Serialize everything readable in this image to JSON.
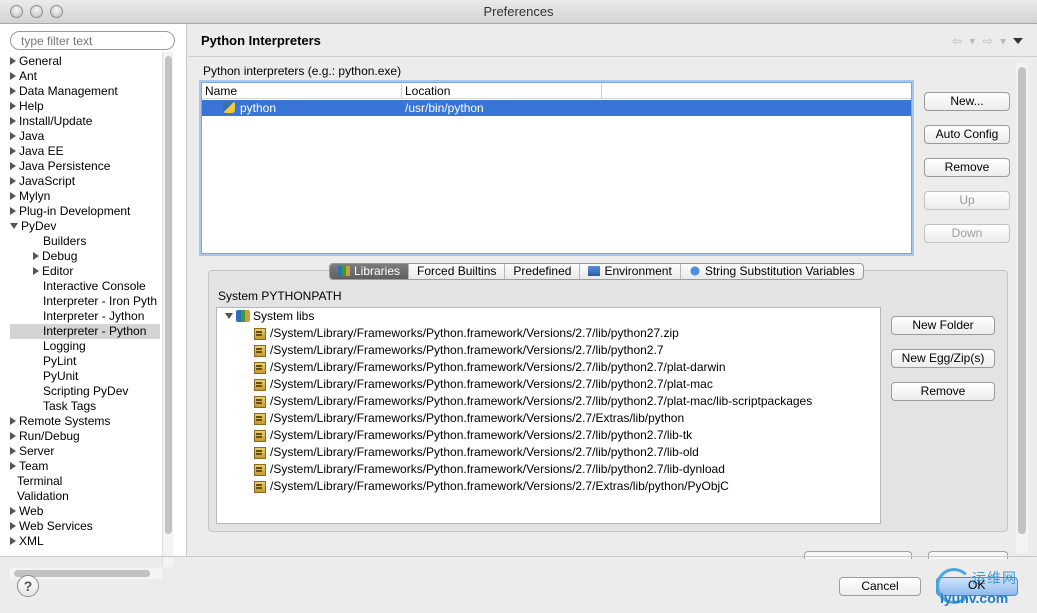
{
  "window": {
    "title": "Preferences"
  },
  "filter": {
    "placeholder": "type filter text"
  },
  "tree": [
    {
      "label": "General",
      "level": 0,
      "expander": "right"
    },
    {
      "label": "Ant",
      "level": 0,
      "expander": "right"
    },
    {
      "label": "Data Management",
      "level": 0,
      "expander": "right"
    },
    {
      "label": "Help",
      "level": 0,
      "expander": "right"
    },
    {
      "label": "Install/Update",
      "level": 0,
      "expander": "right"
    },
    {
      "label": "Java",
      "level": 0,
      "expander": "right"
    },
    {
      "label": "Java EE",
      "level": 0,
      "expander": "right"
    },
    {
      "label": "Java Persistence",
      "level": 0,
      "expander": "right"
    },
    {
      "label": "JavaScript",
      "level": 0,
      "expander": "right"
    },
    {
      "label": "Mylyn",
      "level": 0,
      "expander": "right"
    },
    {
      "label": "Plug-in Development",
      "level": 0,
      "expander": "right"
    },
    {
      "label": "PyDev",
      "level": 0,
      "expander": "down"
    },
    {
      "label": "Builders",
      "level": 1,
      "expander": "none"
    },
    {
      "label": "Debug",
      "level": 1,
      "expander": "right"
    },
    {
      "label": "Editor",
      "level": 1,
      "expander": "right"
    },
    {
      "label": "Interactive Console",
      "level": 1,
      "expander": "none"
    },
    {
      "label": "Interpreter - Iron Pyth",
      "level": 1,
      "expander": "none"
    },
    {
      "label": "Interpreter - Jython",
      "level": 1,
      "expander": "none"
    },
    {
      "label": "Interpreter - Python",
      "level": 1,
      "expander": "none",
      "selected": true
    },
    {
      "label": "Logging",
      "level": 1,
      "expander": "none"
    },
    {
      "label": "PyLint",
      "level": 1,
      "expander": "none"
    },
    {
      "label": "PyUnit",
      "level": 1,
      "expander": "none"
    },
    {
      "label": "Scripting PyDev",
      "level": 1,
      "expander": "none"
    },
    {
      "label": "Task Tags",
      "level": 1,
      "expander": "none"
    },
    {
      "label": "Remote Systems",
      "level": 0,
      "expander": "right"
    },
    {
      "label": "Run/Debug",
      "level": 0,
      "expander": "right"
    },
    {
      "label": "Server",
      "level": 0,
      "expander": "right"
    },
    {
      "label": "Team",
      "level": 0,
      "expander": "right"
    },
    {
      "label": "Terminal",
      "level": 0,
      "expander": "none"
    },
    {
      "label": "Validation",
      "level": 0,
      "expander": "none"
    },
    {
      "label": "Web",
      "level": 0,
      "expander": "right"
    },
    {
      "label": "Web Services",
      "level": 0,
      "expander": "right"
    },
    {
      "label": "XML",
      "level": 0,
      "expander": "right"
    }
  ],
  "page": {
    "title": "Python Interpreters",
    "nav_arrows": "⇦ ▾ ⇨ ▾"
  },
  "interpreters": {
    "label": "Python interpreters (e.g.: python.exe)",
    "columns": {
      "name": "Name",
      "location": "Location"
    },
    "rows": [
      {
        "name": "python",
        "location": "/usr/bin/python"
      }
    ],
    "buttons": {
      "new": "New...",
      "auto_config": "Auto Config",
      "remove": "Remove",
      "up": "Up",
      "down": "Down"
    }
  },
  "tabs": [
    {
      "label": "Libraries",
      "active": true,
      "icon": "libraries-icon"
    },
    {
      "label": "Forced Builtins",
      "active": false
    },
    {
      "label": "Predefined",
      "active": false
    },
    {
      "label": "Environment",
      "active": false,
      "icon": "environment-icon"
    },
    {
      "label": "String Substitution Variables",
      "active": false,
      "icon": "variables-icon"
    }
  ],
  "libraries": {
    "section_label": "System PYTHONPATH",
    "root": "System libs",
    "paths": [
      "/System/Library/Frameworks/Python.framework/Versions/2.7/lib/python27.zip",
      "/System/Library/Frameworks/Python.framework/Versions/2.7/lib/python2.7",
      "/System/Library/Frameworks/Python.framework/Versions/2.7/lib/python2.7/plat-darwin",
      "/System/Library/Frameworks/Python.framework/Versions/2.7/lib/python2.7/plat-mac",
      "/System/Library/Frameworks/Python.framework/Versions/2.7/lib/python2.7/plat-mac/lib-scriptpackages",
      "/System/Library/Frameworks/Python.framework/Versions/2.7/Extras/lib/python",
      "/System/Library/Frameworks/Python.framework/Versions/2.7/lib/python2.7/lib-tk",
      "/System/Library/Frameworks/Python.framework/Versions/2.7/lib/python2.7/lib-old",
      "/System/Library/Frameworks/Python.framework/Versions/2.7/lib/python2.7/lib-dynload",
      "/System/Library/Frameworks/Python.framework/Versions/2.7/Extras/lib/python/PyObjC"
    ],
    "buttons": {
      "new_folder": "New Folder",
      "new_egg": "New Egg/Zip(s)",
      "remove": "Remove"
    }
  },
  "footer": {
    "help": "?",
    "cancel": "Cancel",
    "ok": "OK",
    "watermark_cn": "运维网",
    "watermark_url": "iyunv.com"
  }
}
